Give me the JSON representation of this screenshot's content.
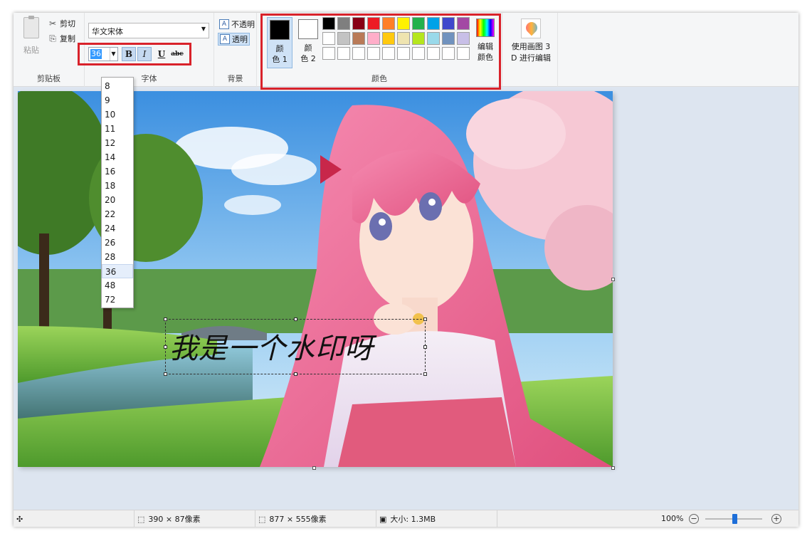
{
  "clipboard": {
    "paste": "粘贴",
    "cut": "剪切",
    "copy": "复制",
    "group": "剪贴板"
  },
  "font": {
    "family": "华文宋体",
    "size": "36",
    "bold": "B",
    "italic": "I",
    "underline": "U",
    "strike": "abc",
    "group": "字体"
  },
  "background": {
    "opaque": "不透明",
    "transparent": "透明",
    "group": "背景"
  },
  "colors": {
    "color1_a": "颜",
    "color1_b": "色 1",
    "color2_a": "颜",
    "color2_b": "色 2",
    "color1_value": "#000000",
    "color2_value": "#ffffff",
    "palette": [
      "#000000",
      "#7f7f7f",
      "#880015",
      "#ed1c24",
      "#ff7f27",
      "#fff200",
      "#22b14c",
      "#00a2e8",
      "#3f48cc",
      "#a349a4",
      "#ffffff",
      "#c3c3c3",
      "#b97a57",
      "#ffaec9",
      "#ffc90e",
      "#efe4b0",
      "#b5e61d",
      "#99d9ea",
      "#7092be",
      "#c8bfe7",
      "#ffffff",
      "#ffffff",
      "#ffffff",
      "#ffffff",
      "#ffffff",
      "#ffffff",
      "#ffffff",
      "#ffffff",
      "#ffffff",
      "#ffffff"
    ],
    "edit_a": "编辑",
    "edit_b": "颜色",
    "group": "颜色"
  },
  "paint3d": {
    "line1": "使用画图 3",
    "line2": "D 进行编辑"
  },
  "canvas": {
    "watermark_text": "我是一个水印呀"
  },
  "size_options": [
    "8",
    "9",
    "10",
    "11",
    "12",
    "14",
    "16",
    "18",
    "20",
    "22",
    "24",
    "26",
    "28",
    "36",
    "48",
    "72"
  ],
  "size_selected": "36",
  "status": {
    "selection": "390 × 87像素",
    "image_size": "877 × 555像素",
    "file_size": "大小: 1.3MB",
    "zoom": "100%",
    "zoom_minus": "−",
    "zoom_plus": "+"
  }
}
